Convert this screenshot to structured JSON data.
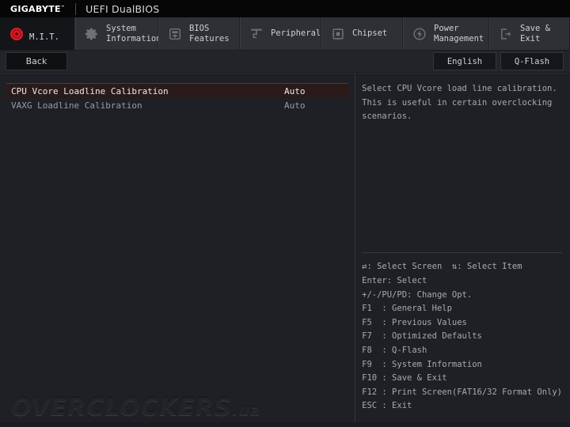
{
  "brand": {
    "logo": "GIGABYTE",
    "trademark": "™",
    "title": "UEFI DualBIOS"
  },
  "tabs": [
    {
      "label": "M.I.T.",
      "icon": "target-icon",
      "active": true
    },
    {
      "label": "System\nInformation",
      "icon": "gear-icon",
      "active": false
    },
    {
      "label": "BIOS\nFeatures",
      "icon": "chip-card-icon",
      "active": false
    },
    {
      "label": "Peripherals",
      "icon": "peripherals-icon",
      "active": false
    },
    {
      "label": "Chipset",
      "icon": "chipset-icon",
      "active": false
    },
    {
      "label": "Power\nManagement",
      "icon": "power-bolt-icon",
      "active": false
    },
    {
      "label": "Save & Exit",
      "icon": "exit-arrow-icon",
      "active": false
    }
  ],
  "toolbar": {
    "back_label": "Back",
    "language_label": "English",
    "qflash_label": "Q-Flash"
  },
  "settings": [
    {
      "label": "CPU Vcore Loadline Calibration",
      "value": "Auto",
      "selected": true
    },
    {
      "label": "VAXG Loadline Calibration",
      "value": "Auto",
      "selected": false
    }
  ],
  "help": {
    "lines": [
      "Select CPU Vcore load line calibration.",
      "This is useful in certain overclocking",
      "scenarios."
    ]
  },
  "legend": {
    "lines": [
      "⇄: Select Screen  ⇅: Select Item",
      "Enter: Select",
      "+/-/PU/PD: Change Opt.",
      "F1  : General Help",
      "F5  : Previous Values",
      "F7  : Optimized Defaults",
      "F8  : Q-Flash",
      "F9  : System Information",
      "F10 : Save & Exit",
      "F12 : Print Screen(FAT16/32 Format Only)",
      "ESC : Exit"
    ]
  },
  "watermark": {
    "main": "OVERCLOCKERS",
    "suffix": ".ua"
  },
  "colors": {
    "accent_red": "#8e1f22",
    "selected_row_bg": "#2b1a1a",
    "panel_bg": "#1f2025",
    "tab_bg": "#2e3036",
    "active_tab_bg": "#141518"
  }
}
